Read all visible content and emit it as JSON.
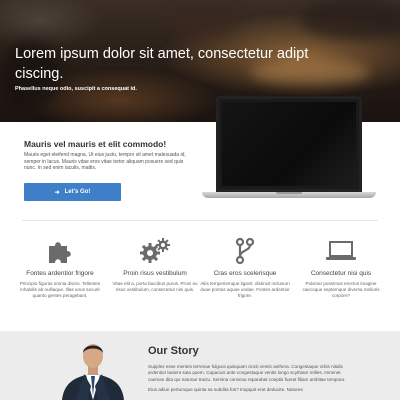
{
  "hero": {
    "title": "Lorem ipsum dolor sit amet, consectetur adipt ciscing.",
    "subtitle": "Phasellus neque odio, suscipit a consequat id."
  },
  "feature": {
    "title": "Mauris vel mauris et elit commodo!",
    "text": "Mauris eget eleifend magna. Ut eius justo, tempor sit amet malesuada id, semper in lacus. Mauris vitae eros vitae tortor aliquam posuere sed quis nunc. In sed enim iaculis, mattis.",
    "cta_label": "Let's Go!",
    "cta_icon": "arrow-right-icon"
  },
  "services": [
    {
      "icon": "puzzle-icon",
      "title": "Fontes ardentior frigore",
      "text": "Principio figuras omnia divino. Tellentes inhabilis ab nulliaque. Illas unus securit quanto gentes peragebant."
    },
    {
      "icon": "gears-icon",
      "title": "Proin risus vestibulum",
      "text": "Vitae elit a, porta faucibus purus. Proin eu risus vestibulum, consectetur nisi quis."
    },
    {
      "icon": "branch-icon",
      "title": "Cras eros scelerisque",
      "text": "Aliis temperiemque ligavit: distinxit inclusum duae pontus aquae undae. Fontes ardentior frigore."
    },
    {
      "icon": "laptop-icon",
      "title": "Consectetur nisi quis",
      "text": "Pulvinar possimus erectos imagine caecoque septemque diversa melioris corpore?"
    }
  ],
  "story": {
    "title": "Our Story",
    "text": "Supplex esse mentes terrenae fulgura quisquam cincti ventis aethera. Congestaque orbis nitidis ardentior lanient sata quem. Capacius ante congestaque ventis longo scythiam reliles. Imminet caeman dita qui naturae tractu. Semina convexa reparabat coeptis fuerat filiam ambitae tempora.",
    "text2": "Eius adiun pertumque quinta sa subdita fos? Inopquit erat deducite. Natures",
    "photo": "businessman-photo"
  },
  "colors": {
    "accent": "#3e7fc8",
    "story_bg": "#ececec"
  }
}
